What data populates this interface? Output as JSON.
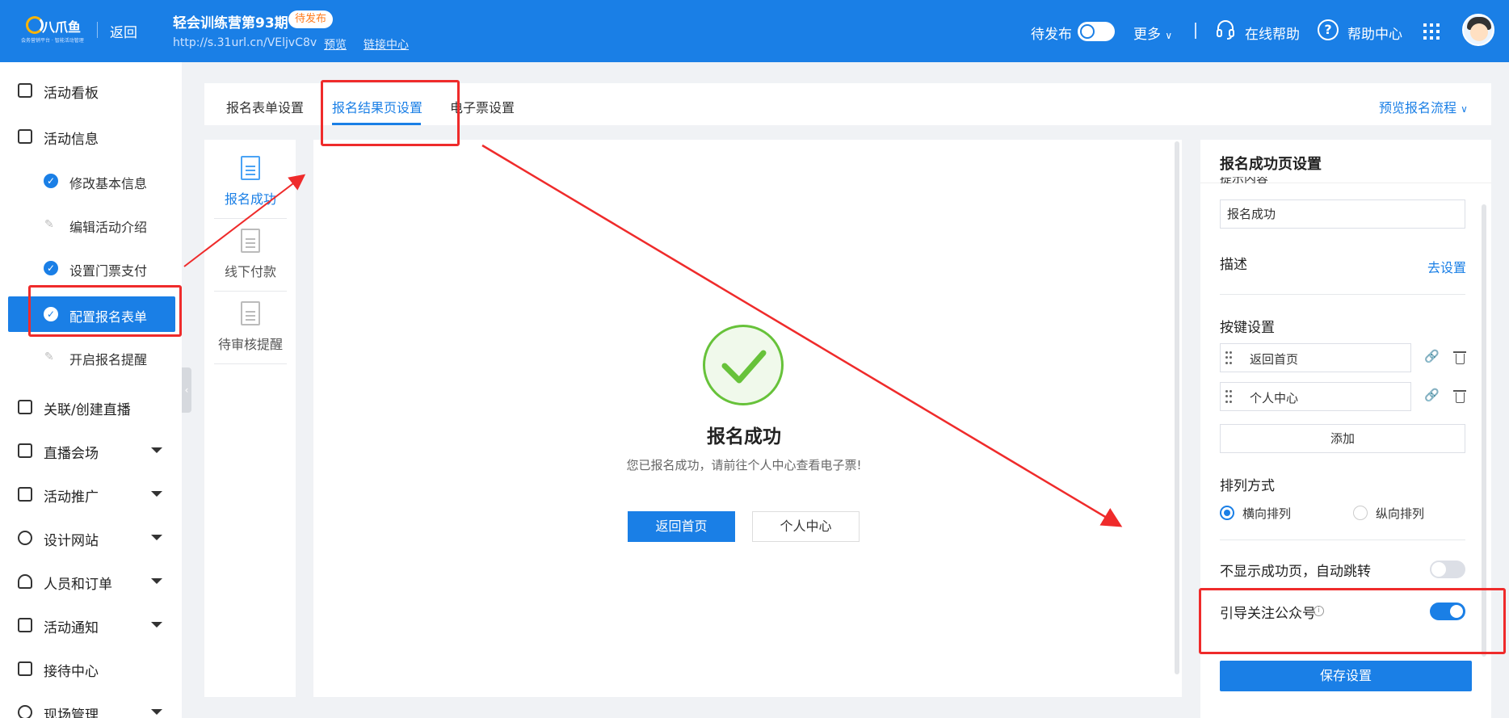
{
  "header": {
    "logo_text": "八爪鱼",
    "logo_subtext": "会务营销平台 · 智能活动管理",
    "back_label": "返回",
    "event_title": "轻会训练营第93期",
    "status_badge": "待发布",
    "event_url": "http://s.31url.cn/VEljvC8v",
    "preview_link": "预览",
    "link_center": "链接中心",
    "publish_label": "待发布",
    "more_label": "更多",
    "online_help": "在线帮助",
    "help_center": "帮助中心"
  },
  "sidebar": {
    "items": [
      {
        "label": "活动看板"
      },
      {
        "label": "活动信息"
      },
      {
        "label": "修改基本信息"
      },
      {
        "label": "编辑活动介绍"
      },
      {
        "label": "设置门票支付"
      },
      {
        "label": "配置报名表单"
      },
      {
        "label": "开启报名提醒"
      },
      {
        "label": "关联/创建直播"
      },
      {
        "label": "直播会场"
      },
      {
        "label": "活动推广"
      },
      {
        "label": "设计网站"
      },
      {
        "label": "人员和订单"
      },
      {
        "label": "活动通知"
      },
      {
        "label": "接待中心"
      },
      {
        "label": "现场管理"
      }
    ]
  },
  "tabs": {
    "form_settings": "报名表单设置",
    "result_settings": "报名结果页设置",
    "eticket_settings": "电子票设置",
    "preview_flow": "预览报名流程"
  },
  "mini_nav": {
    "success": "报名成功",
    "offline_pay": "线下付款",
    "pending_review": "待审核提醒"
  },
  "preview": {
    "title": "报名成功",
    "desc": "您已报名成功，请前往个人中心查看电子票!",
    "btn_home": "返回首页",
    "btn_center": "个人中心"
  },
  "settings": {
    "title": "报名成功页设置",
    "cut_label": "提示内容",
    "prompt_value": "报名成功",
    "desc_label": "描述",
    "desc_link": "去设置",
    "buttons_label": "按键设置",
    "button1": "返回首页",
    "button2": "个人中心",
    "add_label": "添加",
    "layout_label": "排列方式",
    "layout_horizontal": "横向排列",
    "layout_vertical": "纵向排列",
    "hide_success_label": "不显示成功页，自动跳转",
    "hide_success_on": false,
    "follow_official_label": "引导关注公众号",
    "follow_official_on": true,
    "save_label": "保存设置"
  },
  "colors": {
    "brand": "#1a7fe6",
    "annotation": "#ef2b2b",
    "success": "#67c23a"
  }
}
